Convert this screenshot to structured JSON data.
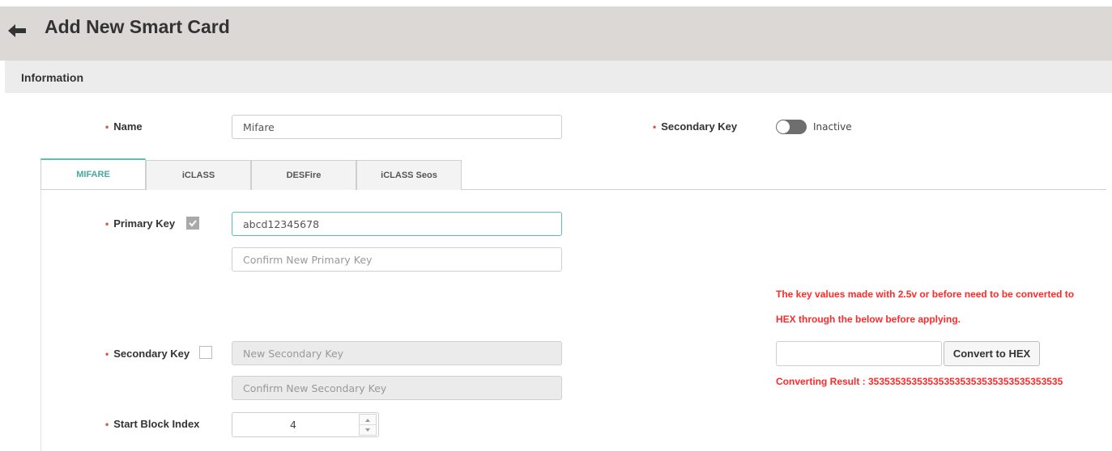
{
  "header": {
    "title": "Add New Smart Card"
  },
  "section": {
    "title": "Information"
  },
  "name_field": {
    "label": "Name",
    "value": "Mifare"
  },
  "secondary_key_toggle": {
    "label": "Secondary Key",
    "state_text": "Inactive"
  },
  "tabs": [
    {
      "label": "MIFARE",
      "active": true
    },
    {
      "label": "iCLASS",
      "active": false
    },
    {
      "label": "DESFire",
      "active": false
    },
    {
      "label": "iCLASS Seos",
      "active": false
    }
  ],
  "primary_key": {
    "label": "Primary Key",
    "checked": true,
    "value": "abcd12345678",
    "confirm_placeholder": "Confirm New Primary Key"
  },
  "secondary_key": {
    "label": "Secondary Key",
    "checked": false,
    "placeholder": "New Secondary Key",
    "confirm_placeholder": "Confirm New Secondary Key"
  },
  "start_block_index": {
    "label": "Start Block Index",
    "value": "4"
  },
  "hex_converter": {
    "warning_line1": "The key values made with 2.5v or before need to be converted to",
    "warning_line2": "HEX through the below before applying.",
    "input_value": "",
    "button_label": "Convert to HEX",
    "result_text": "Converting Result : 353535353535353535353535353535353535"
  },
  "colors": {
    "accent": "#5bbfb5",
    "required_dot": "#e74c3c",
    "warning": "#ff2a2a",
    "header_bg": "#dcd8d6"
  }
}
